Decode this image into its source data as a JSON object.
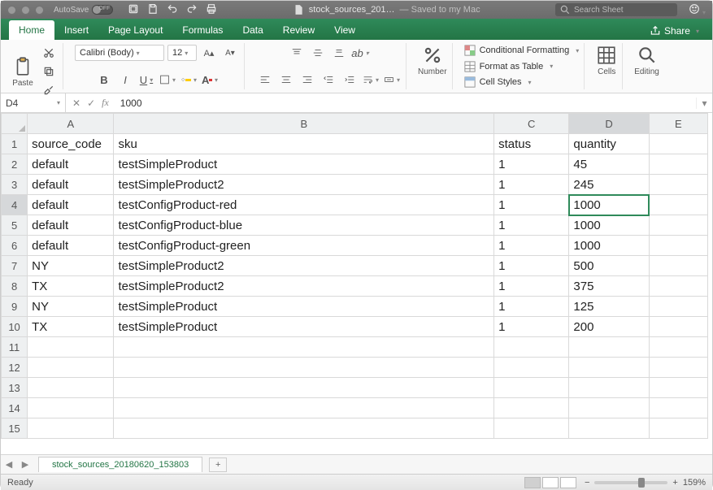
{
  "titlebar": {
    "autosave": "AutoSave",
    "filename": "stock_sources_201…",
    "saved": "— Saved to my Mac",
    "search_placeholder": "Search Sheet"
  },
  "tabs": {
    "items": [
      "Home",
      "Insert",
      "Page Layout",
      "Formulas",
      "Data",
      "Review",
      "View"
    ],
    "active": 0,
    "share": "Share"
  },
  "ribbon": {
    "paste": "Paste",
    "font_name": "Calibri (Body)",
    "font_size": "12",
    "number": "Number",
    "cf": "Conditional Formatting",
    "fat": "Format as Table",
    "cs": "Cell Styles",
    "cells": "Cells",
    "editing": "Editing"
  },
  "formula": {
    "namebox": "D4",
    "value": "1000"
  },
  "columns": [
    "A",
    "B",
    "C",
    "D",
    "E"
  ],
  "rows": [
    "1",
    "2",
    "3",
    "4",
    "5",
    "6",
    "7",
    "8",
    "9",
    "10",
    "11",
    "12",
    "13",
    "14",
    "15"
  ],
  "selected": {
    "row": 4,
    "col": "D"
  },
  "data": [
    {
      "A": "source_code",
      "B": "sku",
      "C": "status",
      "D": "quantity",
      "E": ""
    },
    {
      "A": "default",
      "B": "testSimpleProduct",
      "C": "1",
      "D": "45",
      "E": ""
    },
    {
      "A": "default",
      "B": "testSimpleProduct2",
      "C": "1",
      "D": "245",
      "E": ""
    },
    {
      "A": "default",
      "B": "testConfigProduct-red",
      "C": "1",
      "D": "1000",
      "E": ""
    },
    {
      "A": "default",
      "B": "testConfigProduct-blue",
      "C": "1",
      "D": "1000",
      "E": ""
    },
    {
      "A": "default",
      "B": "testConfigProduct-green",
      "C": "1",
      "D": "1000",
      "E": ""
    },
    {
      "A": "NY",
      "B": "testSimpleProduct2",
      "C": "1",
      "D": "500",
      "E": ""
    },
    {
      "A": "TX",
      "B": "testSimpleProduct2",
      "C": "1",
      "D": "375",
      "E": ""
    },
    {
      "A": "NY",
      "B": "testSimpleProduct",
      "C": "1",
      "D": "125",
      "E": ""
    },
    {
      "A": "TX",
      "B": "testSimpleProduct",
      "C": "1",
      "D": "200",
      "E": ""
    },
    {
      "A": "",
      "B": "",
      "C": "",
      "D": "",
      "E": ""
    },
    {
      "A": "",
      "B": "",
      "C": "",
      "D": "",
      "E": ""
    },
    {
      "A": "",
      "B": "",
      "C": "",
      "D": "",
      "E": ""
    },
    {
      "A": "",
      "B": "",
      "C": "",
      "D": "",
      "E": ""
    },
    {
      "A": "",
      "B": "",
      "C": "",
      "D": "",
      "E": ""
    }
  ],
  "sheet": {
    "name": "stock_sources_20180620_153803"
  },
  "status": {
    "ready": "Ready",
    "zoom": "159%"
  }
}
